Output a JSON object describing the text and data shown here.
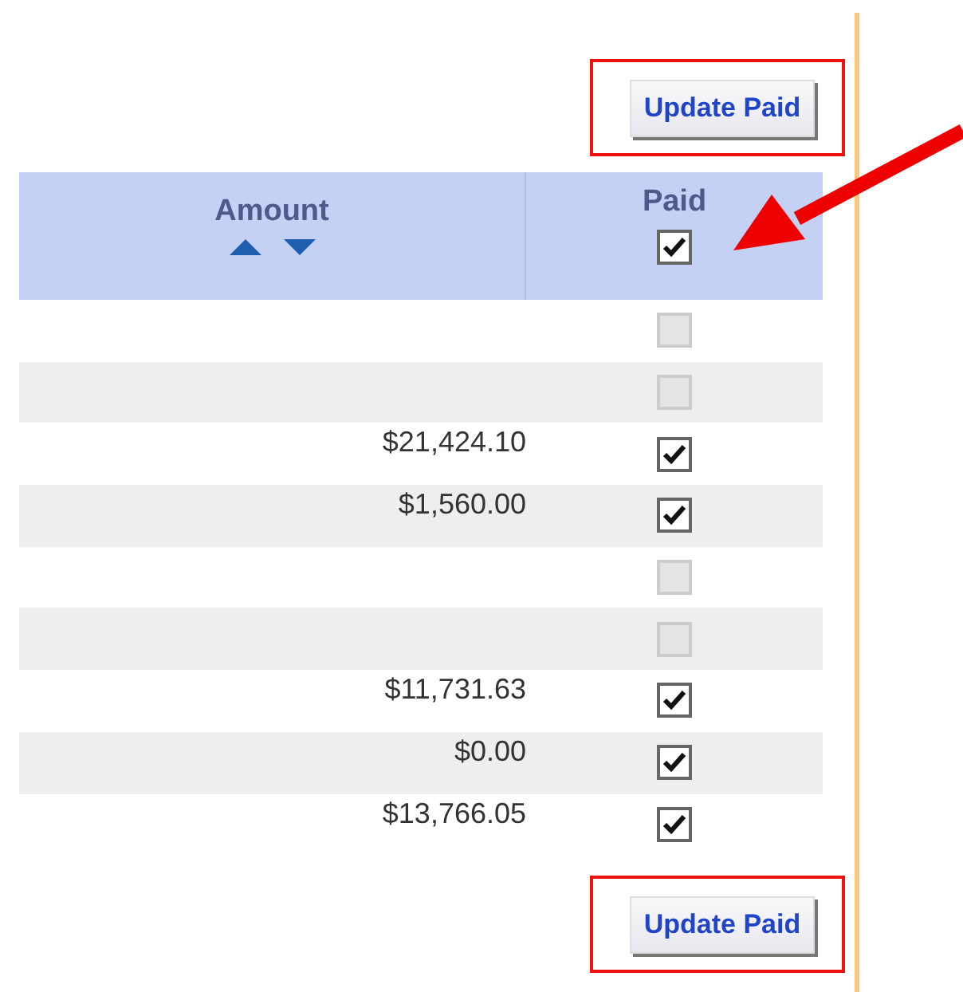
{
  "top_button": {
    "label": "Update Paid"
  },
  "table": {
    "columns": [
      {
        "label": "Amount",
        "kind": "sortable"
      },
      {
        "label": "Paid",
        "kind": "checkbox",
        "checked": true
      }
    ],
    "rows": [
      {
        "amount": "",
        "paid": false
      },
      {
        "amount": "",
        "paid": false
      },
      {
        "amount": "$21,424.10",
        "paid": true
      },
      {
        "amount": "$1,560.00",
        "paid": true
      },
      {
        "amount": "",
        "paid": false
      },
      {
        "amount": "",
        "paid": false
      },
      {
        "amount": "$11,731.63",
        "paid": true
      },
      {
        "amount": "$0.00",
        "paid": true
      },
      {
        "amount": "$13,766.05",
        "paid": true
      }
    ]
  },
  "bottom_button": {
    "label": "Update Paid"
  }
}
